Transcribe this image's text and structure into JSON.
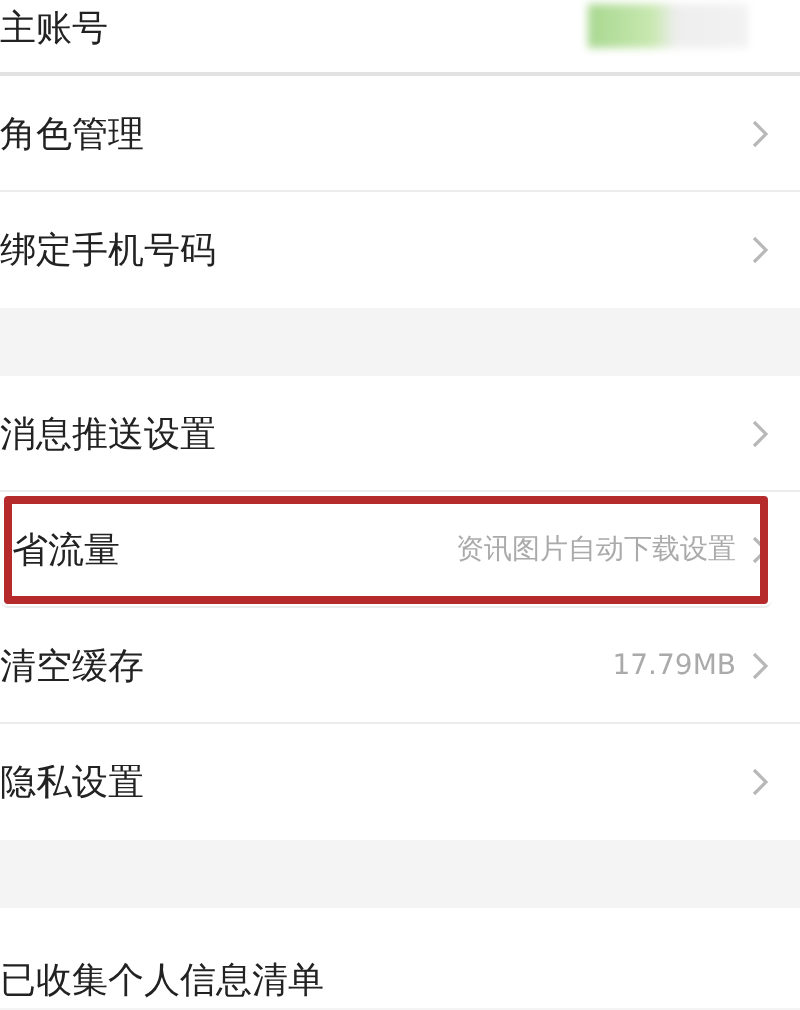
{
  "sections": [
    {
      "rows": [
        {
          "label": "主账号",
          "masked": true,
          "chevron": false,
          "highlighted": false
        },
        {
          "label": "角色管理",
          "chevron": true,
          "highlighted": false
        },
        {
          "label": "绑定手机号码",
          "chevron": true,
          "highlighted": false
        }
      ]
    },
    {
      "rows": [
        {
          "label": "消息推送设置",
          "chevron": true,
          "highlighted": false
        },
        {
          "label": "省流量",
          "value": "资讯图片自动下载设置",
          "chevron": true,
          "highlighted": true
        },
        {
          "label": "清空缓存",
          "value": "17.79MB",
          "chevron": true,
          "highlighted": false
        },
        {
          "label": "隐私设置",
          "chevron": true,
          "highlighted": false
        }
      ]
    },
    {
      "rows": [
        {
          "label": "已收集个人信息清单",
          "chevron": false,
          "highlighted": false
        }
      ]
    }
  ]
}
